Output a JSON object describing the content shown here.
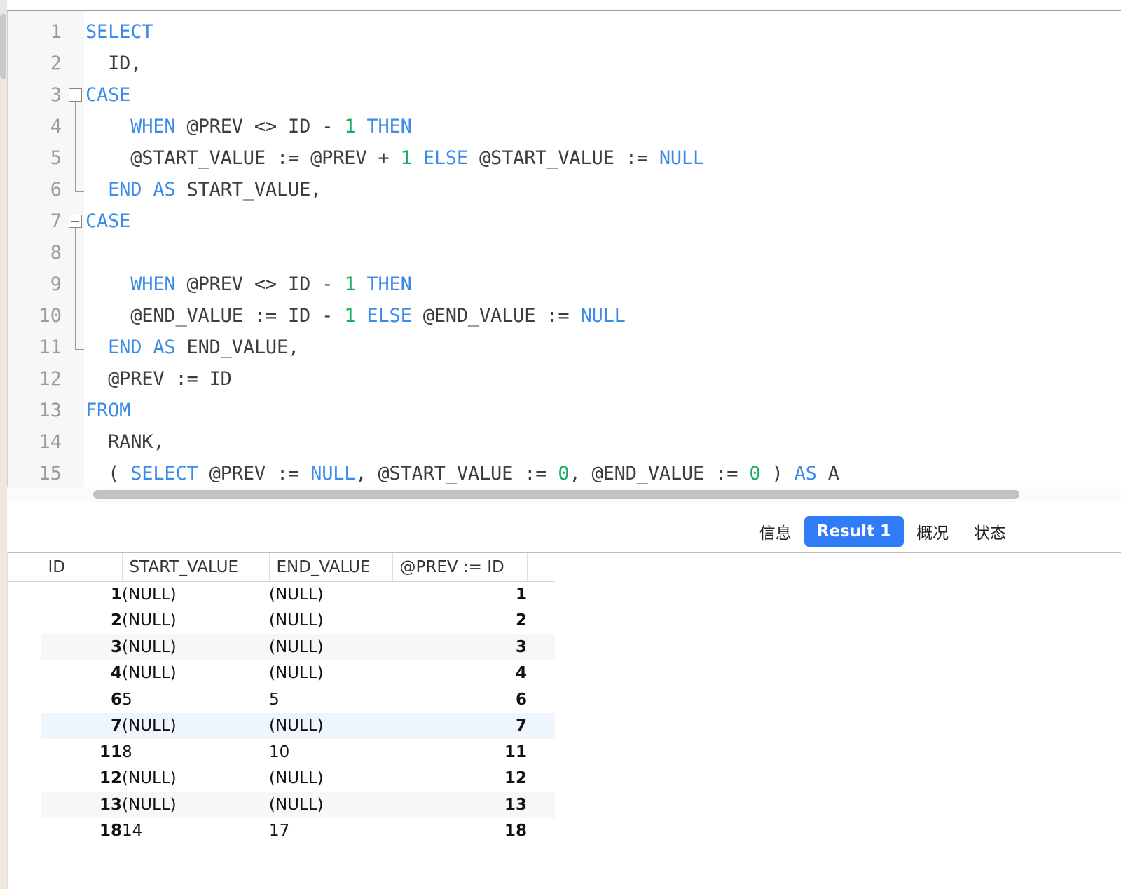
{
  "editor": {
    "language": "sql",
    "lines": [
      {
        "n": "1",
        "tokens": [
          {
            "t": "SELECT",
            "c": "kw"
          }
        ]
      },
      {
        "n": "2",
        "tokens": [
          {
            "t": "  ID,",
            "c": ""
          }
        ]
      },
      {
        "n": "3",
        "tokens": [
          {
            "t": "CASE",
            "c": "kw"
          }
        ],
        "fold": "start"
      },
      {
        "n": "4",
        "tokens": [
          {
            "t": "    ",
            "c": ""
          },
          {
            "t": "WHEN",
            "c": "kw"
          },
          {
            "t": " @PREV <> ID - ",
            "c": ""
          },
          {
            "t": "1",
            "c": "num"
          },
          {
            "t": " ",
            "c": ""
          },
          {
            "t": "THEN",
            "c": "kw"
          }
        ]
      },
      {
        "n": "5",
        "tokens": [
          {
            "t": "    @START_VALUE := @PREV + ",
            "c": ""
          },
          {
            "t": "1",
            "c": "num"
          },
          {
            "t": " ",
            "c": ""
          },
          {
            "t": "ELSE",
            "c": "kw"
          },
          {
            "t": " @START_VALUE := ",
            "c": ""
          },
          {
            "t": "NULL",
            "c": "kw"
          }
        ]
      },
      {
        "n": "6",
        "tokens": [
          {
            "t": "  ",
            "c": ""
          },
          {
            "t": "END",
            "c": "kw"
          },
          {
            "t": " ",
            "c": ""
          },
          {
            "t": "AS",
            "c": "kw"
          },
          {
            "t": " START_VALUE,",
            "c": ""
          }
        ],
        "fold": "end"
      },
      {
        "n": "7",
        "tokens": [
          {
            "t": "CASE",
            "c": "kw"
          }
        ],
        "fold": "start2"
      },
      {
        "n": "8",
        "tokens": [
          {
            "t": "",
            "c": ""
          }
        ]
      },
      {
        "n": "9",
        "tokens": [
          {
            "t": "    ",
            "c": ""
          },
          {
            "t": "WHEN",
            "c": "kw"
          },
          {
            "t": " @PREV <> ID - ",
            "c": ""
          },
          {
            "t": "1",
            "c": "num"
          },
          {
            "t": " ",
            "c": ""
          },
          {
            "t": "THEN",
            "c": "kw"
          }
        ]
      },
      {
        "n": "10",
        "tokens": [
          {
            "t": "    @END_VALUE := ID - ",
            "c": ""
          },
          {
            "t": "1",
            "c": "num"
          },
          {
            "t": " ",
            "c": ""
          },
          {
            "t": "ELSE",
            "c": "kw"
          },
          {
            "t": " @END_VALUE := ",
            "c": ""
          },
          {
            "t": "NULL",
            "c": "kw"
          }
        ]
      },
      {
        "n": "11",
        "tokens": [
          {
            "t": "  ",
            "c": ""
          },
          {
            "t": "END",
            "c": "kw"
          },
          {
            "t": " ",
            "c": ""
          },
          {
            "t": "AS",
            "c": "kw"
          },
          {
            "t": " END_VALUE,",
            "c": ""
          }
        ],
        "fold": "end2"
      },
      {
        "n": "12",
        "tokens": [
          {
            "t": "  @PREV := ID",
            "c": ""
          }
        ]
      },
      {
        "n": "13",
        "tokens": [
          {
            "t": "FROM",
            "c": "kw"
          }
        ]
      },
      {
        "n": "14",
        "tokens": [
          {
            "t": "  RANK,",
            "c": ""
          }
        ]
      },
      {
        "n": "15",
        "tokens": [
          {
            "t": "  ( ",
            "c": ""
          },
          {
            "t": "SELECT",
            "c": "kw"
          },
          {
            "t": " @PREV := ",
            "c": ""
          },
          {
            "t": "NULL",
            "c": "kw"
          },
          {
            "t": ", @START_VALUE := ",
            "c": ""
          },
          {
            "t": "0",
            "c": "num"
          },
          {
            "t": ", @END_VALUE := ",
            "c": ""
          },
          {
            "t": "0",
            "c": "num"
          },
          {
            "t": " ) ",
            "c": ""
          },
          {
            "t": "AS",
            "c": "kw"
          },
          {
            "t": " A",
            "c": ""
          }
        ]
      }
    ]
  },
  "tabs": [
    {
      "label": "信息",
      "active": false
    },
    {
      "label": "Result 1",
      "active": true
    },
    {
      "label": "概况",
      "active": false
    },
    {
      "label": "状态",
      "active": false
    }
  ],
  "result_grid": {
    "columns": [
      "ID",
      "START_VALUE",
      "END_VALUE",
      "@PREV := ID"
    ],
    "rows": [
      {
        "ID": "1",
        "START_VALUE": "(NULL)",
        "END_VALUE": "(NULL)",
        "PREV": "1",
        "style": ""
      },
      {
        "ID": "2",
        "START_VALUE": "(NULL)",
        "END_VALUE": "(NULL)",
        "PREV": "2",
        "style": ""
      },
      {
        "ID": "3",
        "START_VALUE": "(NULL)",
        "END_VALUE": "(NULL)",
        "PREV": "3",
        "style": "stripe"
      },
      {
        "ID": "4",
        "START_VALUE": "(NULL)",
        "END_VALUE": "(NULL)",
        "PREV": "4",
        "style": ""
      },
      {
        "ID": "6",
        "START_VALUE": "5",
        "END_VALUE": "5",
        "PREV": "6",
        "style": ""
      },
      {
        "ID": "7",
        "START_VALUE": "(NULL)",
        "END_VALUE": "(NULL)",
        "PREV": "7",
        "style": "selected"
      },
      {
        "ID": "11",
        "START_VALUE": "8",
        "END_VALUE": "10",
        "PREV": "11",
        "style": ""
      },
      {
        "ID": "12",
        "START_VALUE": "(NULL)",
        "END_VALUE": "(NULL)",
        "PREV": "12",
        "style": ""
      },
      {
        "ID": "13",
        "START_VALUE": "(NULL)",
        "END_VALUE": "(NULL)",
        "PREV": "13",
        "style": "stripe"
      },
      {
        "ID": "18",
        "START_VALUE": "14",
        "END_VALUE": "17",
        "PREV": "18",
        "style": ""
      }
    ]
  },
  "colors": {
    "keyword": "#3b8ce8",
    "number": "#17ae5e",
    "active_tab": "#2f7cf6",
    "selected_row": "#eef5fd",
    "null_text": "#b0b0b0"
  }
}
